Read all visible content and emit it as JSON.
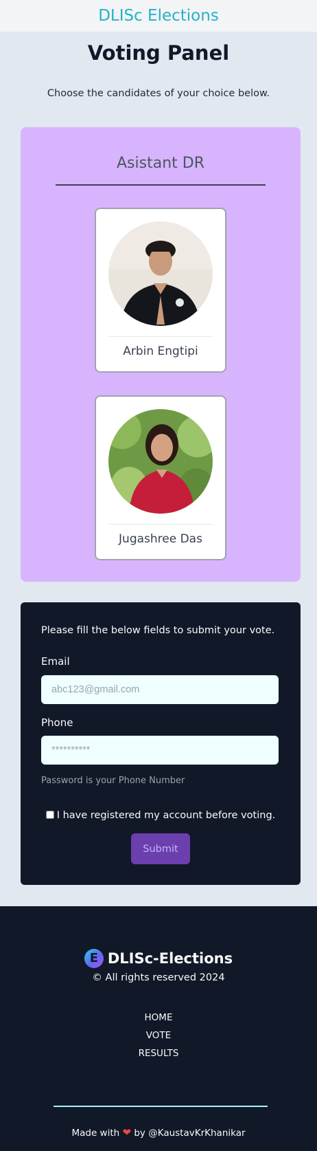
{
  "header": {
    "brand": "DLISc Elections"
  },
  "main": {
    "title": "Voting Panel",
    "subtitle": "Choose the candidates of your choice below."
  },
  "panel": {
    "post_title": "Asistant DR",
    "candidates": [
      {
        "name": "Arbin Engtipi"
      },
      {
        "name": "Jugashree Das"
      }
    ]
  },
  "form": {
    "intro": "Please fill the below fields to submit your vote.",
    "email_label": "Email",
    "email_placeholder": "abc123@gmail.com",
    "phone_label": "Phone",
    "phone_placeholder": "**********",
    "hint": "Password is your Phone Number",
    "checkbox_label": "I have registered my account before voting.",
    "checkbox_checked": false,
    "submit_label": "Submit"
  },
  "footer": {
    "logo_letter": "E",
    "brand": "DLISc-Elections",
    "copyright": "© All rights reserved 2024",
    "nav": [
      "HOME",
      "VOTE",
      "RESULTS"
    ],
    "made_with_prefix": "Made with",
    "heart": "❤",
    "made_with_suffix": "by @KaustavKrKhanikar"
  },
  "colors": {
    "brand": "#22b3c7",
    "panel_bg": "#d8b4fe",
    "dark_bg": "#111827",
    "submit_bg": "#6b3fae",
    "heart": "#ef4444"
  }
}
